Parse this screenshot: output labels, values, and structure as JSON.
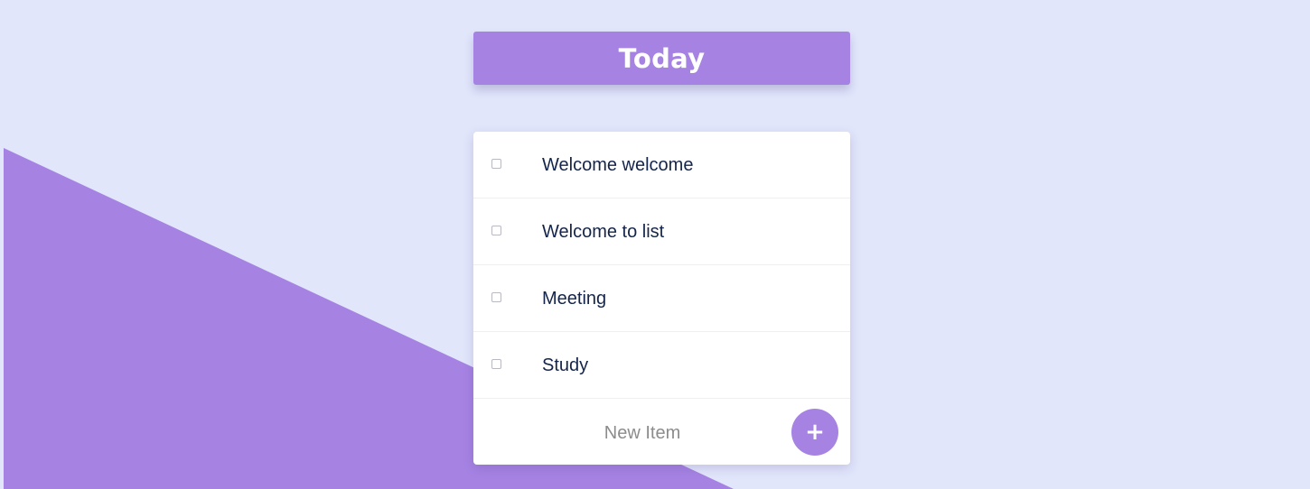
{
  "app": {
    "heading": "Today",
    "colors": {
      "background": "#E1E6FB",
      "accent": "#A683E3",
      "text": "#14244A",
      "placeholder": "#8C8C8C"
    }
  },
  "list": {
    "items": [
      {
        "label": "Welcome welcome",
        "checked": false
      },
      {
        "label": "Welcome to list",
        "checked": false
      },
      {
        "label": "Meeting",
        "checked": false
      },
      {
        "label": "Study",
        "checked": false
      }
    ]
  },
  "new_item": {
    "placeholder": "New Item",
    "value": "",
    "add_label": "+",
    "add_icon": "plus-icon"
  }
}
